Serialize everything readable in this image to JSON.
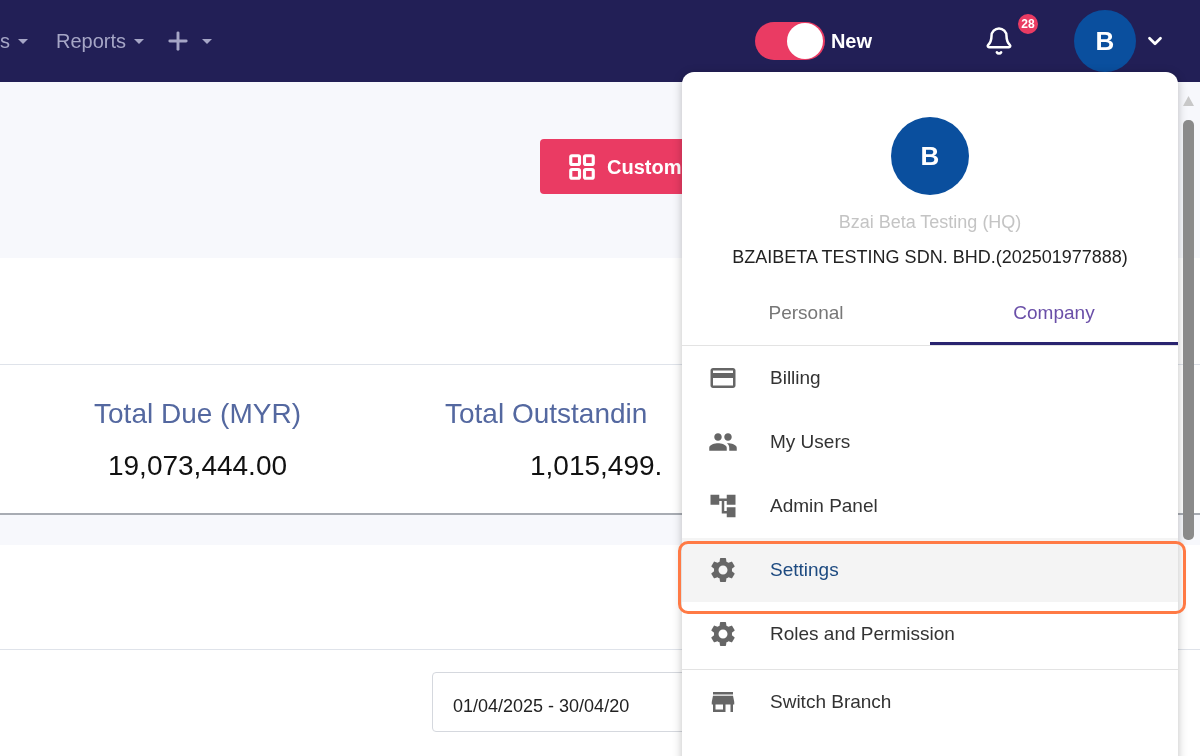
{
  "nav": {
    "items": [
      {
        "label": "s"
      },
      {
        "label": "Reports"
      }
    ]
  },
  "toggle": {
    "label": "New",
    "on": true
  },
  "notifications": {
    "badge": "28"
  },
  "avatar": {
    "initial": "B"
  },
  "toolbar": {
    "custom_button": "Custom"
  },
  "stats": [
    {
      "label": "Total Due (MYR)",
      "value": "19,073,444.00"
    },
    {
      "label": "Total Outstandin",
      "value": "1,015,499."
    }
  ],
  "date_range": {
    "value": "01/04/2025 - 30/04/20"
  },
  "account_menu": {
    "avatar_initial": "B",
    "branch_name": "Bzai Beta Testing (HQ)",
    "company_name": "BZAIBETA TESTING SDN. BHD.(202501977888)",
    "tabs": [
      {
        "label": "Personal",
        "selected": false
      },
      {
        "label": "Company",
        "selected": true
      }
    ],
    "items": [
      {
        "label": "Billing",
        "selected": false,
        "divider_before": false
      },
      {
        "label": "My Users",
        "selected": false,
        "divider_before": false
      },
      {
        "label": "Admin Panel",
        "selected": false,
        "divider_before": false
      },
      {
        "label": "Settings",
        "selected": true,
        "divider_before": false
      },
      {
        "label": "Roles and Permission",
        "selected": false,
        "divider_before": false
      },
      {
        "label": "Switch Branch",
        "selected": false,
        "divider_before": true
      }
    ]
  }
}
